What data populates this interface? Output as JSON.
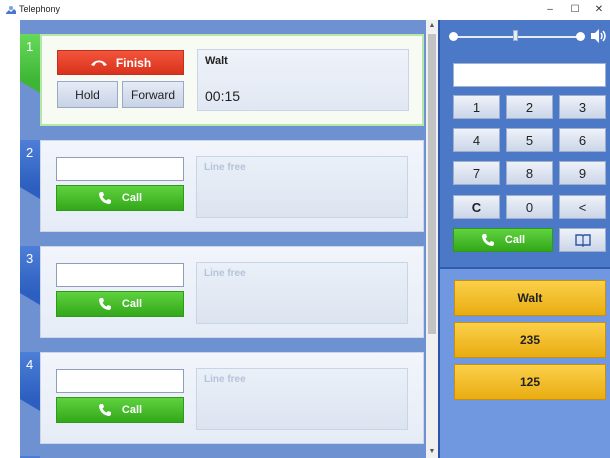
{
  "window": {
    "title": "Telephony",
    "minimize": "–",
    "maximize": "☐",
    "close": "✕"
  },
  "lines": [
    {
      "number": "1",
      "state": "active",
      "finish_label": "Finish",
      "hold_label": "Hold",
      "forward_label": "Forward",
      "caller": "Walt",
      "timer": "00:15"
    },
    {
      "number": "2",
      "state": "free",
      "call_label": "Call",
      "status": "Line free",
      "input_value": ""
    },
    {
      "number": "3",
      "state": "free",
      "call_label": "Call",
      "status": "Line free",
      "input_value": ""
    },
    {
      "number": "4",
      "state": "free",
      "call_label": "Call",
      "status": "Line free",
      "input_value": ""
    }
  ],
  "dialer": {
    "input_value": "",
    "keys": [
      "1",
      "2",
      "3",
      "4",
      "5",
      "6",
      "7",
      "8",
      "9",
      "C",
      "0",
      "<"
    ],
    "call_label": "Call",
    "volume_level": 0.5
  },
  "contacts": [
    "Walt",
    "235",
    "125"
  ],
  "colors": {
    "active_accent": "#3fb536",
    "line_accent": "#2c5fbf",
    "finish_red": "#e0391f",
    "call_green": "#3cb522",
    "contact_gold": "#f0b92a",
    "background_blue": "#6e91d2"
  }
}
